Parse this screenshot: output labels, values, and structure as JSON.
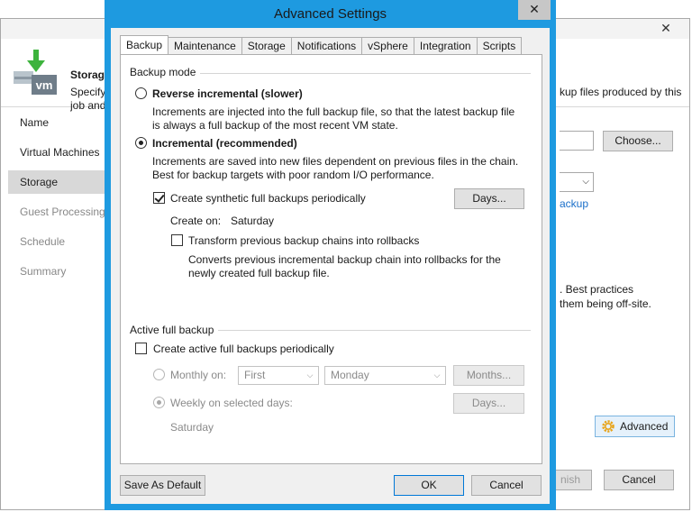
{
  "background_window": {
    "close_glyph": "✕",
    "header": {
      "title": "Storag",
      "description_line1": "Specify",
      "description_line2": "job and",
      "description_right": "kup files produced by this"
    },
    "nav": [
      {
        "label": "Name",
        "state": "normal"
      },
      {
        "label": "Virtual Machines",
        "state": "normal"
      },
      {
        "label": "Storage",
        "state": "selected"
      },
      {
        "label": "Guest Processing",
        "state": "disabled"
      },
      {
        "label": "Schedule",
        "state": "disabled"
      },
      {
        "label": "Summary",
        "state": "disabled"
      }
    ],
    "choose_button": "Choose...",
    "backup_link": "ackup",
    "best_practices_line1": ". Best practices",
    "best_practices_line2": "them being off-site.",
    "advanced_button": "Advanced",
    "finish_button": "nish",
    "cancel_button": "Cancel"
  },
  "dialog": {
    "title": "Advanced Settings",
    "close_glyph": "✕",
    "tabs": [
      "Backup",
      "Maintenance",
      "Storage",
      "Notifications",
      "vSphere",
      "Integration",
      "Scripts"
    ],
    "active_tab": "Backup",
    "backup_mode": {
      "label": "Backup mode",
      "reverse_incremental": {
        "label": "Reverse incremental (slower)",
        "selected": false,
        "description_line1": "Increments are injected into the full backup file, so that the latest backup file",
        "description_line2": "is always a full backup of the most recent VM state."
      },
      "incremental": {
        "label": "Incremental (recommended)",
        "selected": true,
        "description_line1": "Increments are saved into new files dependent on previous files in the chain.",
        "description_line2": "Best for backup targets with poor random I/O performance."
      },
      "synthetic_full": {
        "label": "Create synthetic full backups periodically",
        "checked": true,
        "days_button": "Days...",
        "create_on_label": "Create on:",
        "create_on_value": "Saturday"
      },
      "transform_chains": {
        "label": "Transform previous backup chains into rollbacks",
        "checked": false,
        "description_line1": "Converts previous incremental backup chain into rollbacks for the",
        "description_line2": "newly created full backup file."
      }
    },
    "active_full": {
      "label": "Active full backup",
      "create_active": {
        "label": "Create active full backups periodically",
        "checked": false
      },
      "monthly": {
        "label": "Monthly on:",
        "week_select": "First",
        "day_select": "Monday",
        "months_button": "Months..."
      },
      "weekly": {
        "label": "Weekly on selected days:",
        "days_button": "Days...",
        "selected_days": "Saturday"
      }
    },
    "footer": {
      "save_default": "Save As Default",
      "ok": "OK",
      "cancel": "Cancel"
    }
  },
  "colors": {
    "dialog_border": "#1e9ae0",
    "link": "#1a6fc9",
    "veeam_green": "#3db33d"
  },
  "icons": {
    "logo": "vm-backup-logo-icon",
    "advanced": "gear-icon",
    "dropdown": "chevron-down-icon"
  }
}
